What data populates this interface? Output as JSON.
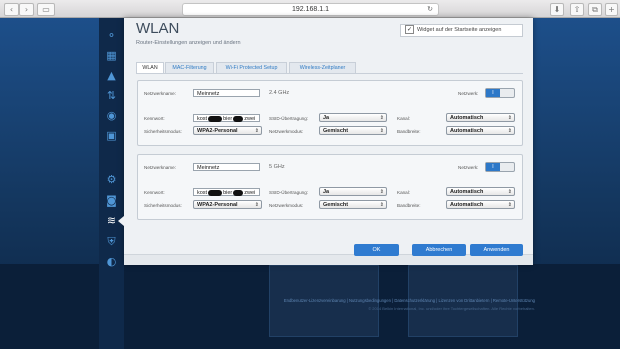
{
  "browser": {
    "url": "192.168.1.1",
    "back_glyph": "‹",
    "forward_glyph": "›",
    "sidebar_glyph": "▭",
    "reload_glyph": "↻",
    "download_glyph": "⬇",
    "share_glyph": "⇧",
    "tabs_glyph": "⧉",
    "add_glyph": "+"
  },
  "nav": {
    "items": [
      {
        "icon": "network-map-icon",
        "glyph": "⚬"
      },
      {
        "icon": "connectivity-icon",
        "glyph": "▦"
      },
      {
        "icon": "warning-icon",
        "glyph": "▲"
      },
      {
        "icon": "media-prioritization-icon",
        "glyph": "⇅"
      },
      {
        "icon": "globe-icon",
        "glyph": "◉"
      },
      {
        "icon": "shield-icon",
        "glyph": "▣"
      },
      {
        "icon": "settings-icon",
        "glyph": "⚙"
      },
      {
        "icon": "camera-icon",
        "glyph": "◙"
      },
      {
        "icon": "wifi-icon",
        "glyph": "≋"
      },
      {
        "icon": "security-icon",
        "glyph": "⛨"
      },
      {
        "icon": "troubleshooting-icon",
        "glyph": "◐"
      }
    ]
  },
  "panel": {
    "title": "WLAN",
    "subtitle": "Router-Einstellungen anzeigen und ändern",
    "start_page_checkbox": "Widget auf der Startseite anzeigen",
    "check_glyph": "✓",
    "tabs": [
      "WLAN",
      "MAC-Filterung",
      "Wi-Fi Protected Setup",
      "Wireless-Zeitplaner"
    ]
  },
  "band24": {
    "network_name_label": "Netzwerkname:",
    "network_name": "Meinnetz",
    "frequency": "2.4 GHz",
    "network_label": "Netzwerk:",
    "toggle": "I",
    "password_label": "Kennwort:",
    "password_prefix": "kost",
    "password_mid": "bier",
    "password_suffix": "zwei",
    "ssid_label": "SSID-Übertragung:",
    "ssid_value": "Ja",
    "channel_label": "Kanal:",
    "channel_value": "Automatisch",
    "security_label": "Sicherheitsmodus:",
    "security_value": "WPA2-Personal",
    "mode_label": "Netzwerkmodus:",
    "mode_value": "Gemischt",
    "bandwidth_label": "Bandbreite:",
    "bandwidth_value": "Automatisch"
  },
  "band5": {
    "network_name_label": "Netzwerkname:",
    "network_name": "Meinnetz",
    "frequency": "5 GHz",
    "network_label": "Netzwerk:",
    "toggle": "I",
    "password_label": "Kennwort:",
    "password_prefix": "kost",
    "password_mid": "bier",
    "password_suffix": "zwei",
    "ssid_label": "SSID-Übertragung:",
    "ssid_value": "Ja",
    "channel_label": "Kanal:",
    "channel_value": "Automatisch",
    "security_label": "Sicherheitsmodus:",
    "security_value": "WPA2-Personal",
    "mode_label": "Netzwerkmodus:",
    "mode_value": "Gemischt",
    "bandwidth_label": "Bandbreite:",
    "bandwidth_value": "Automatisch"
  },
  "select_arrow": "⇕",
  "buttons": {
    "ok": "OK",
    "cancel": "Abbrechen",
    "apply": "Anwenden"
  },
  "footer": {
    "links": "Endbenutzer-Lizenzvereinbarung  |  Nutzungsbedingungen  |  Datenschutzerklärung  |  Lizenzen von Drittanbietern  |  Remote-Unterstützung",
    "copyright": "© 2014 Belkin International, Inc. und/oder ihre Tochtergesellschaften. Alle Rechte vorbehalten."
  },
  "colors": {
    "accent": "#2f7bd0",
    "panel": "#eef1f4",
    "nav": "#0f294a"
  }
}
